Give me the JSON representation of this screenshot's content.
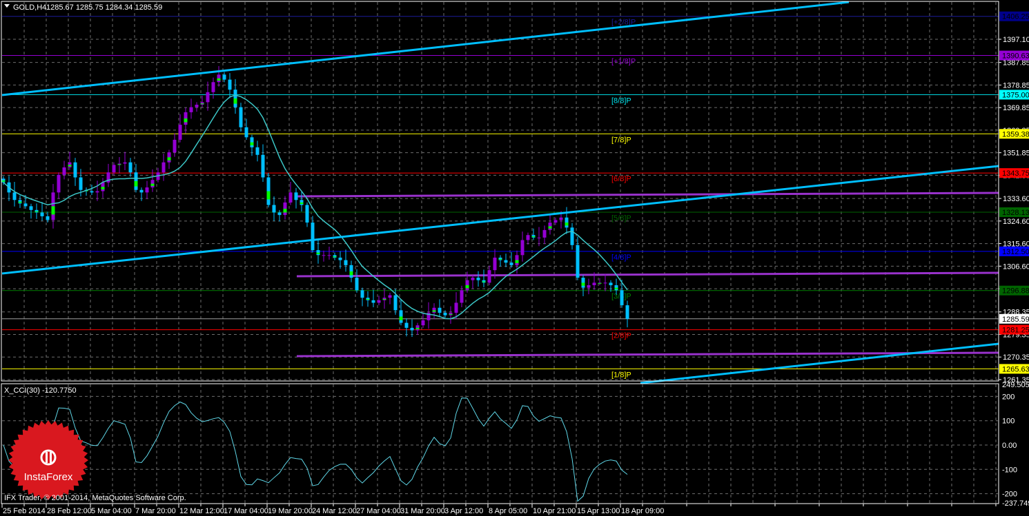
{
  "header": {
    "symbol": "GOLD,H4",
    "ohlc": "1285.67 1285.75 1284.34 1285.59"
  },
  "indicator": {
    "title": "X_CCI(30) -120.7750",
    "axis_labels": [
      {
        "value": 249.5052,
        "text": "249.5052"
      },
      {
        "value": 200,
        "text": "200"
      },
      {
        "value": 100,
        "text": "100"
      },
      {
        "value": 0,
        "text": "0.00"
      },
      {
        "value": -100,
        "text": "-100"
      },
      {
        "value": -200,
        "text": "-200"
      },
      {
        "value": -237.7497,
        "text": "-237.7497"
      }
    ],
    "color": "#5fd7e8"
  },
  "copyright": "IFX Trader, © 2001-2014, MetaQuotes Software Corp.",
  "logo": {
    "text": "InstaForex",
    "color": "#d9181f"
  },
  "colors": {
    "bull": "#9400d3",
    "bear": "#00bfff",
    "wick_accent": "#00ff00",
    "ma": "#3cc8c8",
    "trendline": "#00bfff",
    "channel": "#9932cc",
    "grid": "#6e6e6e"
  },
  "chart_data": {
    "type": "candlestick",
    "symbol": "GOLD",
    "timeframe": "H4",
    "ylim": [
      1261.35,
      1406.25
    ],
    "grid": true,
    "price_ticks": [
      "1397.10",
      "1387.85",
      "1378.85",
      "1369.85",
      "1360.85",
      "1351.85",
      "1342.85",
      "1333.60",
      "1324.60",
      "1315.60",
      "1306.60",
      "1297.60",
      "1288.35",
      "1279.35",
      "1270.35",
      "1261.35"
    ],
    "time_ticks": [
      "25 Feb 2014",
      "28 Feb 12:00",
      "5 Mar 04:00",
      "7 Mar 20:00",
      "12 Mar 12:00",
      "17 Mar 04:00",
      "19 Mar 20:00",
      "24 Mar 12:00",
      "27 Mar 04:00",
      "31 Mar 20:00",
      "3 Apr 12:00",
      "8 Apr 05:00",
      "10 Apr 21:00",
      "15 Apr 13:00",
      "18 Apr 09:00"
    ],
    "closes": [
      1340,
      1336,
      1333,
      1331.6,
      1330.5,
      1329,
      1328,
      1326.5,
      1325,
      1336,
      1343,
      1346,
      1348,
      1342,
      1337,
      1336.5,
      1336,
      1336.5,
      1340,
      1344,
      1347,
      1347.5,
      1348,
      1344,
      1337,
      1336,
      1338,
      1341,
      1344,
      1348,
      1352,
      1357,
      1363,
      1368,
      1370,
      1371,
      1372,
      1376,
      1380,
      1383,
      1381,
      1377,
      1370,
      1362,
      1358,
      1354,
      1351,
      1342,
      1331,
      1328,
      1327,
      1332,
      1336,
      1333,
      1331,
      1324,
      1313,
      1311,
      1311,
      1311,
      1310,
      1309,
      1307,
      1302,
      1297,
      1294,
      1293,
      1292,
      1293,
      1294,
      1295,
      1289,
      1284,
      1282,
      1281,
      1283,
      1285,
      1288,
      1290,
      1288,
      1287,
      1288,
      1292,
      1297,
      1301,
      1302,
      1301,
      1300,
      1305,
      1310,
      1309,
      1308,
      1307,
      1311,
      1317,
      1319,
      1318,
      1318,
      1321,
      1324,
      1325,
      1326,
      1322,
      1315,
      1302,
      1298,
      1299,
      1300,
      1300,
      1300,
      1299,
      1297,
      1291,
      1285.59
    ],
    "last_price": {
      "value": 1285.59,
      "text": "1285.59"
    },
    "murrey_levels": [
      {
        "label": "[+2/8]P",
        "price": 1406.25,
        "tag": "1406.25",
        "color": "#1c1c9c",
        "tag_bg": "#00008b"
      },
      {
        "label": "[+1/8]P",
        "price": 1390.63,
        "tag": "1390.63",
        "color": "#9400d3",
        "tag_bg": "#9400d3"
      },
      {
        "label": "[8/8]P",
        "price": 1375.0,
        "tag": "1375.00",
        "color": "#00e5ee",
        "tag_bg": "#00ffff"
      },
      {
        "label": "[7/8]P",
        "price": 1359.38,
        "tag": "1359.38",
        "color": "#ffff00",
        "tag_bg": "#ffff00"
      },
      {
        "label": "[6/8]P",
        "price": 1343.75,
        "tag": "1343.75",
        "color": "#ff0000",
        "tag_bg": "#ff0000"
      },
      {
        "label": "[5/8]P",
        "price": 1328.13,
        "tag": "1328.13",
        "color": "#006400",
        "tag_bg": "#006400"
      },
      {
        "label": "[4/8]P",
        "price": 1312.5,
        "tag": "1312.50",
        "color": "#0000ff",
        "tag_bg": "#0000ff"
      },
      {
        "label": "[3/8]P",
        "price": 1296.88,
        "tag": "1296.88",
        "color": "#008000",
        "tag_bg": "#006400"
      },
      {
        "label": "[2/8]P",
        "price": 1281.25,
        "tag": "1281.25",
        "color": "#ff0000",
        "tag_bg": "#ff0000"
      },
      {
        "label": "[1/8]P",
        "price": 1265.63,
        "tag": "1265.63",
        "color": "#ffff00",
        "tag_bg": "#ffff00"
      }
    ]
  }
}
